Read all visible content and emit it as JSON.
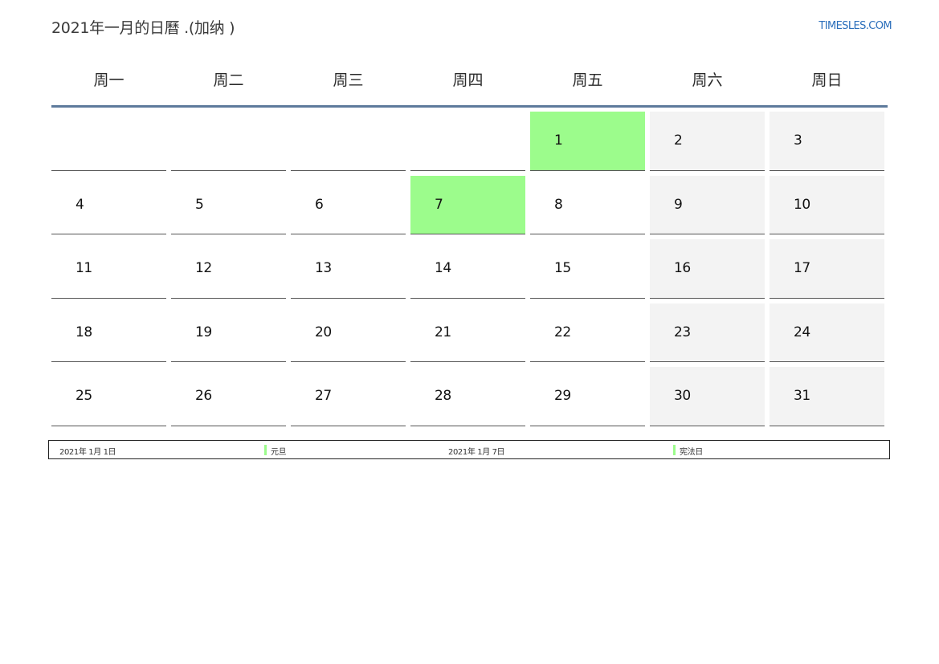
{
  "header": {
    "title": "2021年一月的日曆 .(加纳 )",
    "site": "TIMESLES.COM"
  },
  "weekdays": [
    "周一",
    "周二",
    "周三",
    "周四",
    "周五",
    "周六",
    "周日"
  ],
  "calendar": {
    "weeks": [
      [
        "",
        "",
        "",
        "",
        "1",
        "2",
        "3"
      ],
      [
        "4",
        "5",
        "6",
        "7",
        "8",
        "9",
        "10"
      ],
      [
        "11",
        "12",
        "13",
        "14",
        "15",
        "16",
        "17"
      ],
      [
        "18",
        "19",
        "20",
        "21",
        "22",
        "23",
        "24"
      ],
      [
        "25",
        "26",
        "27",
        "28",
        "29",
        "30",
        "31"
      ]
    ],
    "holidays": [
      "1",
      "7"
    ]
  },
  "legend": [
    {
      "date": "2021年 1月 1日",
      "name": "元旦"
    },
    {
      "date": "2021年 1月 7日",
      "name": "宪法日"
    }
  ],
  "colors": {
    "holiday": "#9cfc8c",
    "weekend": "#f3f3f3",
    "header_rule": "#5d7a9c",
    "link": "#2a6ebb"
  }
}
